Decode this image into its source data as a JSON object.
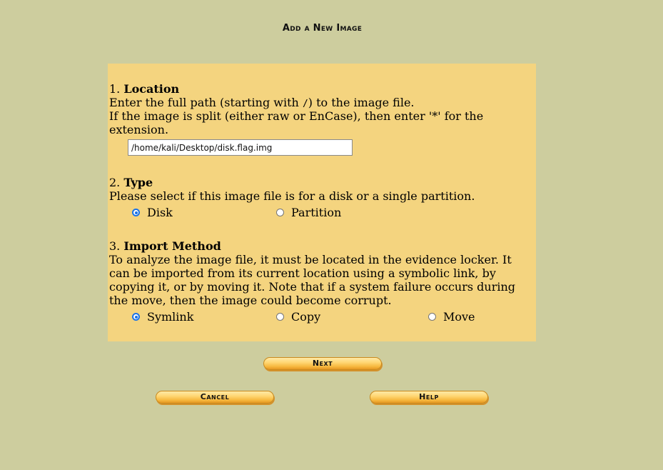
{
  "title": "Add a New Image",
  "location": {
    "number": "1.",
    "heading": "Location",
    "line1_before": "Enter the full path (starting with ",
    "line1_code": "/",
    "line1_after": ") to the image file.",
    "line2": "If the image is split (either raw or EnCase), then enter '*' for the",
    "line3": "extension.",
    "input_value": "/home/kali/Desktop/disk.flag.img"
  },
  "type": {
    "number": "2.",
    "heading": "Type",
    "description": "Please select if this image file is for a disk or a single partition.",
    "options": [
      {
        "label": "Disk",
        "checked": true
      },
      {
        "label": "Partition",
        "checked": false
      }
    ]
  },
  "import": {
    "number": "3.",
    "heading": "Import Method",
    "lines": [
      "To analyze the image file, it must be located in the evidence locker. It",
      "can be imported from its current location using a symbolic link, by",
      "copying it, or by moving it. Note that if a system failure occurs during",
      "the move, then the image could become corrupt."
    ],
    "options": [
      {
        "label": "Symlink",
        "checked": true
      },
      {
        "label": "Copy",
        "checked": false
      },
      {
        "label": "Move",
        "checked": false
      }
    ]
  },
  "buttons": {
    "next": "Next",
    "cancel": "Cancel",
    "help": "Help"
  }
}
